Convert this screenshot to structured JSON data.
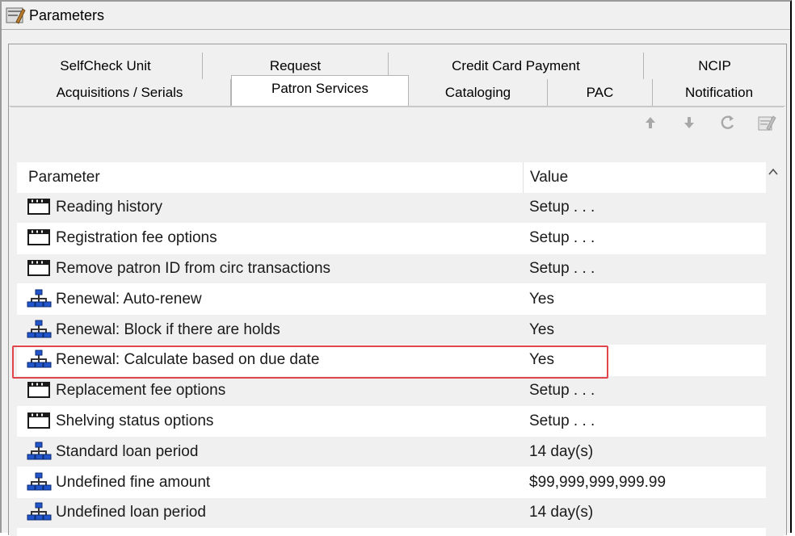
{
  "window": {
    "title": "Parameters"
  },
  "tabs": {
    "row1": [
      {
        "label": "SelfCheck Unit"
      },
      {
        "label": "Request"
      },
      {
        "label": "Credit Card Payment"
      },
      {
        "label": "NCIP"
      }
    ],
    "row2": [
      {
        "label": "Acquisitions / Serials"
      },
      {
        "label": "Patron Services"
      },
      {
        "label": "Cataloging"
      },
      {
        "label": "PAC"
      },
      {
        "label": "Notification"
      }
    ],
    "active": "Patron Services"
  },
  "toolbar": {
    "icons": [
      "arrow-up-icon",
      "arrow-down-icon",
      "refresh-icon",
      "properties-icon"
    ]
  },
  "grid": {
    "columns": [
      "Parameter",
      "Value"
    ],
    "rows": [
      {
        "icon": "folder-icon",
        "param": "Reading history",
        "value": "Setup . . ."
      },
      {
        "icon": "folder-icon",
        "param": "Registration fee options",
        "value": "Setup . . ."
      },
      {
        "icon": "folder-icon",
        "param": "Remove patron ID from circ transactions",
        "value": "Setup . . ."
      },
      {
        "icon": "network-icon",
        "param": "Renewal: Auto-renew",
        "value": "Yes"
      },
      {
        "icon": "network-icon",
        "param": "Renewal: Block if there are holds",
        "value": "Yes"
      },
      {
        "icon": "network-icon",
        "param": "Renewal: Calculate based on due date",
        "value": "Yes"
      },
      {
        "icon": "folder-icon",
        "param": "Replacement fee options",
        "value": "Setup . . ."
      },
      {
        "icon": "folder-icon",
        "param": "Shelving status options",
        "value": "Setup . . ."
      },
      {
        "icon": "network-icon",
        "param": "Standard loan period",
        "value": "14 day(s)"
      },
      {
        "icon": "network-icon",
        "param": "Undefined fine amount",
        "value": "$99,999,999,999.99"
      },
      {
        "icon": "network-icon",
        "param": "Undefined loan period",
        "value": "14 day(s)"
      }
    ]
  },
  "colors": {
    "highlight": "#e0454b",
    "icon_blue": "#2255cc"
  }
}
